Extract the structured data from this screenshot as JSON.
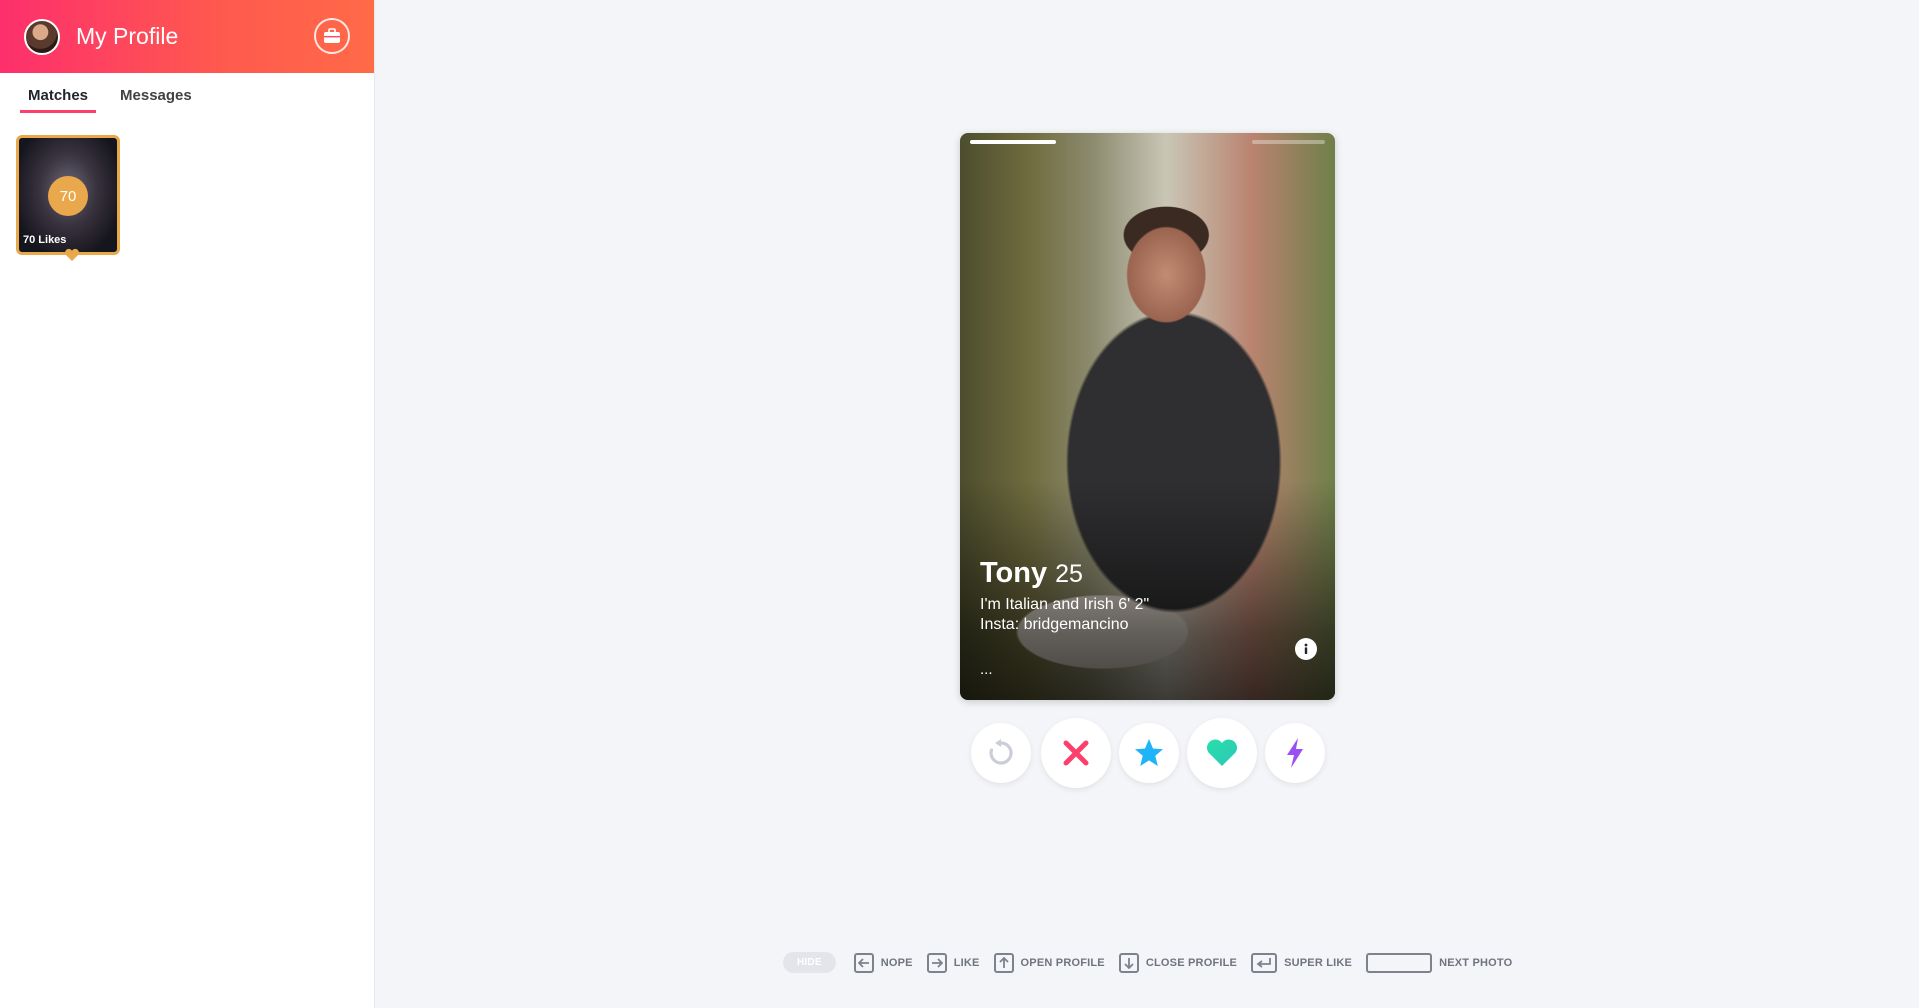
{
  "sidebar": {
    "header": {
      "title": "My Profile"
    },
    "tabs": [
      {
        "label": "Matches",
        "active": true
      },
      {
        "label": "Messages",
        "active": false
      }
    ],
    "likes_tile": {
      "count": "70",
      "label": "70 Likes"
    }
  },
  "card": {
    "name": "Tony",
    "age": "25",
    "bio": [
      "I'm Italian and Irish 6' 2\"",
      "Insta: bridgemancino"
    ],
    "more": "..."
  },
  "actions": [
    {
      "name": "rewind-button",
      "icon": "rewind-icon"
    },
    {
      "name": "nope-button",
      "icon": "x-icon"
    },
    {
      "name": "super-like-button",
      "icon": "star-icon"
    },
    {
      "name": "like-button",
      "icon": "heart-icon"
    },
    {
      "name": "boost-button",
      "icon": "lightning-icon"
    }
  ],
  "hints": {
    "hide": "HIDE",
    "nope": "NOPE",
    "like": "LIKE",
    "open_profile": "OPEN PROFILE",
    "close_profile": "CLOSE PROFILE",
    "super_like": "SUPER LIKE",
    "next_photo": "NEXT PHOTO"
  },
  "colors": {
    "brand_start": "#fd2f6c",
    "brand_end": "#ff6a47",
    "gold": "#e9a84b",
    "nope": "#fd3f6b",
    "super_like": "#1fb4f7",
    "like": "#27e0a9",
    "boost": "#9b4ff2"
  }
}
